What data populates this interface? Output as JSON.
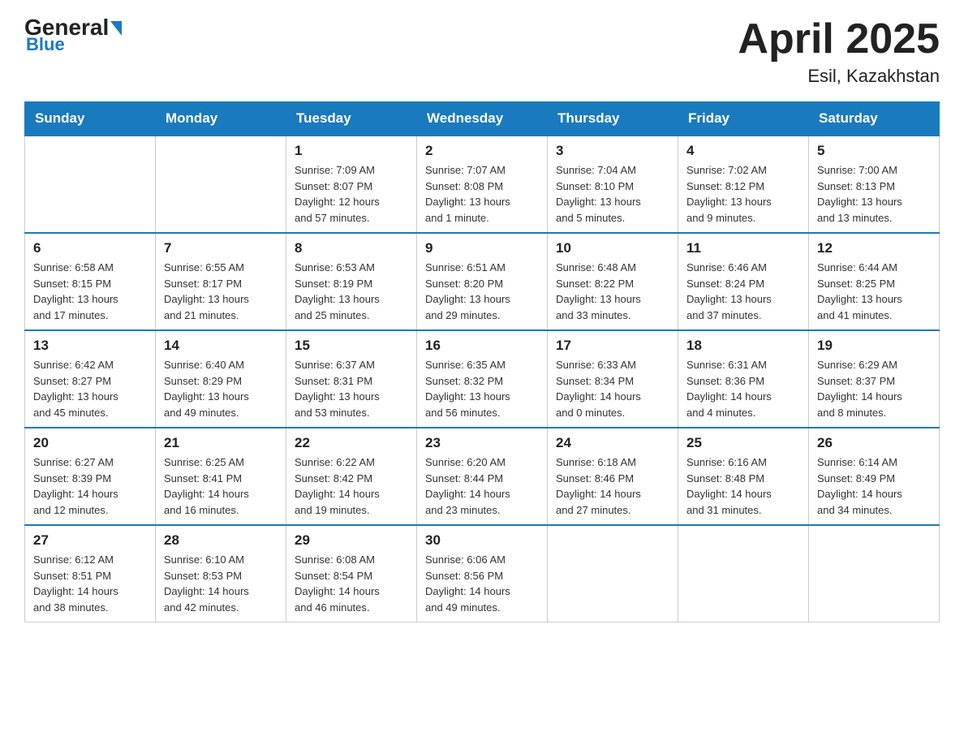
{
  "header": {
    "logo": {
      "general": "General",
      "blue": "Blue"
    },
    "title": "April 2025",
    "location": "Esil, Kazakhstan"
  },
  "days_of_week": [
    "Sunday",
    "Monday",
    "Tuesday",
    "Wednesday",
    "Thursday",
    "Friday",
    "Saturday"
  ],
  "weeks": [
    [
      {
        "day": "",
        "info": ""
      },
      {
        "day": "",
        "info": ""
      },
      {
        "day": "1",
        "info": "Sunrise: 7:09 AM\nSunset: 8:07 PM\nDaylight: 12 hours\nand 57 minutes."
      },
      {
        "day": "2",
        "info": "Sunrise: 7:07 AM\nSunset: 8:08 PM\nDaylight: 13 hours\nand 1 minute."
      },
      {
        "day": "3",
        "info": "Sunrise: 7:04 AM\nSunset: 8:10 PM\nDaylight: 13 hours\nand 5 minutes."
      },
      {
        "day": "4",
        "info": "Sunrise: 7:02 AM\nSunset: 8:12 PM\nDaylight: 13 hours\nand 9 minutes."
      },
      {
        "day": "5",
        "info": "Sunrise: 7:00 AM\nSunset: 8:13 PM\nDaylight: 13 hours\nand 13 minutes."
      }
    ],
    [
      {
        "day": "6",
        "info": "Sunrise: 6:58 AM\nSunset: 8:15 PM\nDaylight: 13 hours\nand 17 minutes."
      },
      {
        "day": "7",
        "info": "Sunrise: 6:55 AM\nSunset: 8:17 PM\nDaylight: 13 hours\nand 21 minutes."
      },
      {
        "day": "8",
        "info": "Sunrise: 6:53 AM\nSunset: 8:19 PM\nDaylight: 13 hours\nand 25 minutes."
      },
      {
        "day": "9",
        "info": "Sunrise: 6:51 AM\nSunset: 8:20 PM\nDaylight: 13 hours\nand 29 minutes."
      },
      {
        "day": "10",
        "info": "Sunrise: 6:48 AM\nSunset: 8:22 PM\nDaylight: 13 hours\nand 33 minutes."
      },
      {
        "day": "11",
        "info": "Sunrise: 6:46 AM\nSunset: 8:24 PM\nDaylight: 13 hours\nand 37 minutes."
      },
      {
        "day": "12",
        "info": "Sunrise: 6:44 AM\nSunset: 8:25 PM\nDaylight: 13 hours\nand 41 minutes."
      }
    ],
    [
      {
        "day": "13",
        "info": "Sunrise: 6:42 AM\nSunset: 8:27 PM\nDaylight: 13 hours\nand 45 minutes."
      },
      {
        "day": "14",
        "info": "Sunrise: 6:40 AM\nSunset: 8:29 PM\nDaylight: 13 hours\nand 49 minutes."
      },
      {
        "day": "15",
        "info": "Sunrise: 6:37 AM\nSunset: 8:31 PM\nDaylight: 13 hours\nand 53 minutes."
      },
      {
        "day": "16",
        "info": "Sunrise: 6:35 AM\nSunset: 8:32 PM\nDaylight: 13 hours\nand 56 minutes."
      },
      {
        "day": "17",
        "info": "Sunrise: 6:33 AM\nSunset: 8:34 PM\nDaylight: 14 hours\nand 0 minutes."
      },
      {
        "day": "18",
        "info": "Sunrise: 6:31 AM\nSunset: 8:36 PM\nDaylight: 14 hours\nand 4 minutes."
      },
      {
        "day": "19",
        "info": "Sunrise: 6:29 AM\nSunset: 8:37 PM\nDaylight: 14 hours\nand 8 minutes."
      }
    ],
    [
      {
        "day": "20",
        "info": "Sunrise: 6:27 AM\nSunset: 8:39 PM\nDaylight: 14 hours\nand 12 minutes."
      },
      {
        "day": "21",
        "info": "Sunrise: 6:25 AM\nSunset: 8:41 PM\nDaylight: 14 hours\nand 16 minutes."
      },
      {
        "day": "22",
        "info": "Sunrise: 6:22 AM\nSunset: 8:42 PM\nDaylight: 14 hours\nand 19 minutes."
      },
      {
        "day": "23",
        "info": "Sunrise: 6:20 AM\nSunset: 8:44 PM\nDaylight: 14 hours\nand 23 minutes."
      },
      {
        "day": "24",
        "info": "Sunrise: 6:18 AM\nSunset: 8:46 PM\nDaylight: 14 hours\nand 27 minutes."
      },
      {
        "day": "25",
        "info": "Sunrise: 6:16 AM\nSunset: 8:48 PM\nDaylight: 14 hours\nand 31 minutes."
      },
      {
        "day": "26",
        "info": "Sunrise: 6:14 AM\nSunset: 8:49 PM\nDaylight: 14 hours\nand 34 minutes."
      }
    ],
    [
      {
        "day": "27",
        "info": "Sunrise: 6:12 AM\nSunset: 8:51 PM\nDaylight: 14 hours\nand 38 minutes."
      },
      {
        "day": "28",
        "info": "Sunrise: 6:10 AM\nSunset: 8:53 PM\nDaylight: 14 hours\nand 42 minutes."
      },
      {
        "day": "29",
        "info": "Sunrise: 6:08 AM\nSunset: 8:54 PM\nDaylight: 14 hours\nand 46 minutes."
      },
      {
        "day": "30",
        "info": "Sunrise: 6:06 AM\nSunset: 8:56 PM\nDaylight: 14 hours\nand 49 minutes."
      },
      {
        "day": "",
        "info": ""
      },
      {
        "day": "",
        "info": ""
      },
      {
        "day": "",
        "info": ""
      }
    ]
  ]
}
